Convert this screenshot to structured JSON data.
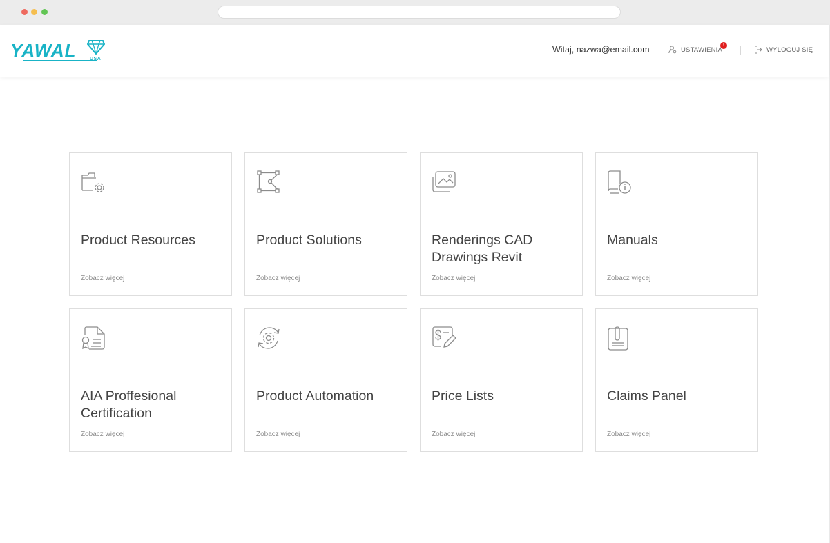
{
  "logo": {
    "text": "YAWAL",
    "sub": "USA"
  },
  "header": {
    "welcome": "Witaj, nazwa@email.com",
    "settings_label": "USTAWIENIA",
    "settings_badge": "!",
    "logout_label": "WYLOGUJ SIĘ"
  },
  "colors": {
    "brand": "#19b3c6",
    "badge": "#e02020",
    "icon": "#8c8c8c"
  },
  "cards": [
    {
      "title": "Product Resources",
      "link": "Zobacz więcej",
      "icon": "folder-gear-icon"
    },
    {
      "title": "Product Solutions",
      "link": "Zobacz więcej",
      "icon": "vector-nodes-icon"
    },
    {
      "title": "Renderings CAD Drawings Revit",
      "link": "Zobacz więcej",
      "icon": "image-gallery-icon"
    },
    {
      "title": "Manuals",
      "link": "Zobacz więcej",
      "icon": "book-info-icon"
    },
    {
      "title": "AIA Proffesional Certification",
      "link": "Zobacz więcej",
      "icon": "certificate-document-icon"
    },
    {
      "title": "Product Automation",
      "link": "Zobacz więcej",
      "icon": "gear-refresh-icon"
    },
    {
      "title": "Price Lists",
      "link": "Zobacz więcej",
      "icon": "price-edit-icon"
    },
    {
      "title": "Claims Panel",
      "link": "Zobacz więcej",
      "icon": "clipboard-paperclip-icon"
    }
  ]
}
